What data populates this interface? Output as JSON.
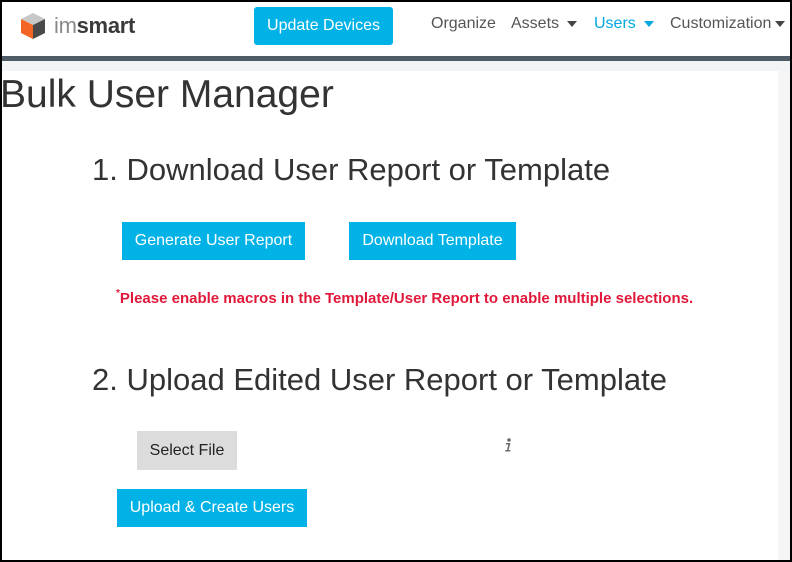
{
  "brand": {
    "logo_prefix": "im",
    "logo_suffix": "smart",
    "icon": "cube-logo-icon",
    "colors": {
      "orange": "#f26522",
      "dark": "#4a4a4a",
      "light": "#c8c8c8"
    }
  },
  "navbar": {
    "update_button": "Update Devices",
    "links": [
      {
        "label": "Organize",
        "dropdown": false,
        "active": false
      },
      {
        "label": "Assets",
        "dropdown": true,
        "active": false
      },
      {
        "label": "Users",
        "dropdown": true,
        "active": true
      },
      {
        "label": "Customization",
        "dropdown": true,
        "active": false
      }
    ]
  },
  "page": {
    "title": "Bulk User Manager",
    "section1": {
      "title": "1. Download User Report or Template",
      "generate_button": "Generate User Report",
      "download_button": "Download Template",
      "note_marker": "*",
      "note": "Please enable macros in the Template/User Report to enable multiple selections."
    },
    "section2": {
      "title": "2. Upload Edited User Report or Template",
      "select_file_button": "Select File",
      "upload_button": "Upload & Create Users",
      "info_icon": "info-icon"
    }
  },
  "colors": {
    "accent": "#00b2e6",
    "active_link": "#00a8df",
    "warning": "#e0193a",
    "nav_rule": "#4f5b66"
  }
}
